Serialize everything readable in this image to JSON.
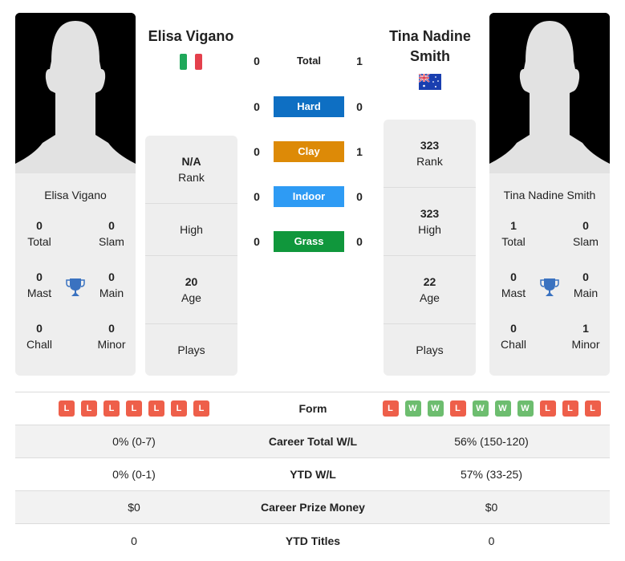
{
  "colors": {
    "hard": "#0e6fc3",
    "clay": "#dd8a07",
    "indoor": "#2e9bf4",
    "grass": "#10973c",
    "loss": "#ee5f4a",
    "win": "#6dbd6f",
    "trophy": "#3a72c0"
  },
  "player1": {
    "name": "Elisa Vigano",
    "card_name": "Elisa Vigano",
    "flag": "italy-flag",
    "titles": {
      "total": {
        "value": "0",
        "label": "Total"
      },
      "slam": {
        "value": "0",
        "label": "Slam"
      },
      "mast": {
        "value": "0",
        "label": "Mast"
      },
      "main": {
        "value": "0",
        "label": "Main"
      },
      "chall": {
        "value": "0",
        "label": "Chall"
      },
      "minor": {
        "value": "0",
        "label": "Minor"
      }
    },
    "stats": {
      "rank": {
        "value": "N/A",
        "label": "Rank"
      },
      "high": {
        "value": "",
        "label": "High"
      },
      "age": {
        "value": "20",
        "label": "Age"
      },
      "plays": {
        "value": "",
        "label": "Plays"
      }
    }
  },
  "player2": {
    "name": "Tina Nadine Smith",
    "card_name": "Tina Nadine Smith",
    "flag": "australia-flag",
    "titles": {
      "total": {
        "value": "1",
        "label": "Total"
      },
      "slam": {
        "value": "0",
        "label": "Slam"
      },
      "mast": {
        "value": "0",
        "label": "Mast"
      },
      "main": {
        "value": "0",
        "label": "Main"
      },
      "chall": {
        "value": "0",
        "label": "Chall"
      },
      "minor": {
        "value": "1",
        "label": "Minor"
      }
    },
    "stats": {
      "rank": {
        "value": "323",
        "label": "Rank"
      },
      "high": {
        "value": "323",
        "label": "High"
      },
      "age": {
        "value": "22",
        "label": "Age"
      },
      "plays": {
        "value": "",
        "label": "Plays"
      }
    }
  },
  "h2h": [
    {
      "label": "Total",
      "p1": "0",
      "p2": "1",
      "surface": "total"
    },
    {
      "label": "Hard",
      "p1": "0",
      "p2": "0",
      "surface": "hard"
    },
    {
      "label": "Clay",
      "p1": "0",
      "p2": "1",
      "surface": "clay"
    },
    {
      "label": "Indoor",
      "p1": "0",
      "p2": "0",
      "surface": "indoor"
    },
    {
      "label": "Grass",
      "p1": "0",
      "p2": "0",
      "surface": "grass"
    }
  ],
  "comparison": {
    "form": {
      "label": "Form",
      "p1": [
        "L",
        "L",
        "L",
        "L",
        "L",
        "L",
        "L"
      ],
      "p2": [
        "L",
        "W",
        "W",
        "L",
        "W",
        "W",
        "W",
        "L",
        "L",
        "L"
      ]
    },
    "rows": [
      {
        "label": "Career Total W/L",
        "p1": "0% (0-7)",
        "p2": "56% (150-120)"
      },
      {
        "label": "YTD W/L",
        "p1": "0% (0-1)",
        "p2": "57% (33-25)"
      },
      {
        "label": "Career Prize Money",
        "p1": "$0",
        "p2": "$0"
      },
      {
        "label": "YTD Titles",
        "p1": "0",
        "p2": "0"
      }
    ]
  }
}
